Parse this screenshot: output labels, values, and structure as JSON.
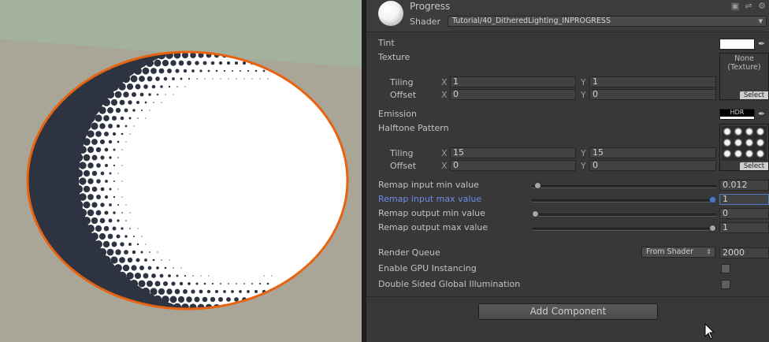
{
  "material": {
    "name": "Progress",
    "shader_label": "Shader",
    "shader_value": "Tutorial/40_DitheredLighting_INPROGRESS"
  },
  "properties": {
    "tint_label": "Tint",
    "texture_label": "Texture",
    "texture_none": "None\n(Texture)",
    "select_label": "Select",
    "tiling_label": "Tiling",
    "offset_label": "Offset",
    "x_label": "X",
    "y_label": "Y",
    "texture_tiling_x": "1",
    "texture_tiling_y": "1",
    "texture_offset_x": "0",
    "texture_offset_y": "0",
    "emission_label": "Emission",
    "hdr_label": "HDR",
    "halftone_label": "Halftone Pattern",
    "halftone_tiling_x": "15",
    "halftone_tiling_y": "15",
    "halftone_offset_x": "0",
    "halftone_offset_y": "0"
  },
  "sliders": [
    {
      "label": "Remap input min value",
      "value": "0.012",
      "fraction": 0.012,
      "active": false
    },
    {
      "label": "Remap input max value",
      "value": "1",
      "fraction": 1.0,
      "active": true
    },
    {
      "label": "Remap output min value",
      "value": "0",
      "fraction": 0.0,
      "active": false
    },
    {
      "label": "Remap output max value",
      "value": "1",
      "fraction": 1.0,
      "active": false
    }
  ],
  "render": {
    "queue_label": "Render Queue",
    "queue_mode": "From Shader",
    "queue_value": "2000",
    "gpu_instancing_label": "Enable GPU Instancing",
    "gpu_instancing": false,
    "double_sided_gi_label": "Double Sided Global Illumination",
    "double_sided_gi": false
  },
  "add_component_label": "Add Component",
  "colors": {
    "accent": "#4e78c8",
    "selection_outline": "#e8630f",
    "dot_color": "#2d3340",
    "tint": "#ffffff"
  },
  "icons": [
    "sphere-preview-icon",
    "book-icon",
    "settings-sliders-icon",
    "gear-icon",
    "eyedropper-icon",
    "mouse-cursor-icon"
  ]
}
